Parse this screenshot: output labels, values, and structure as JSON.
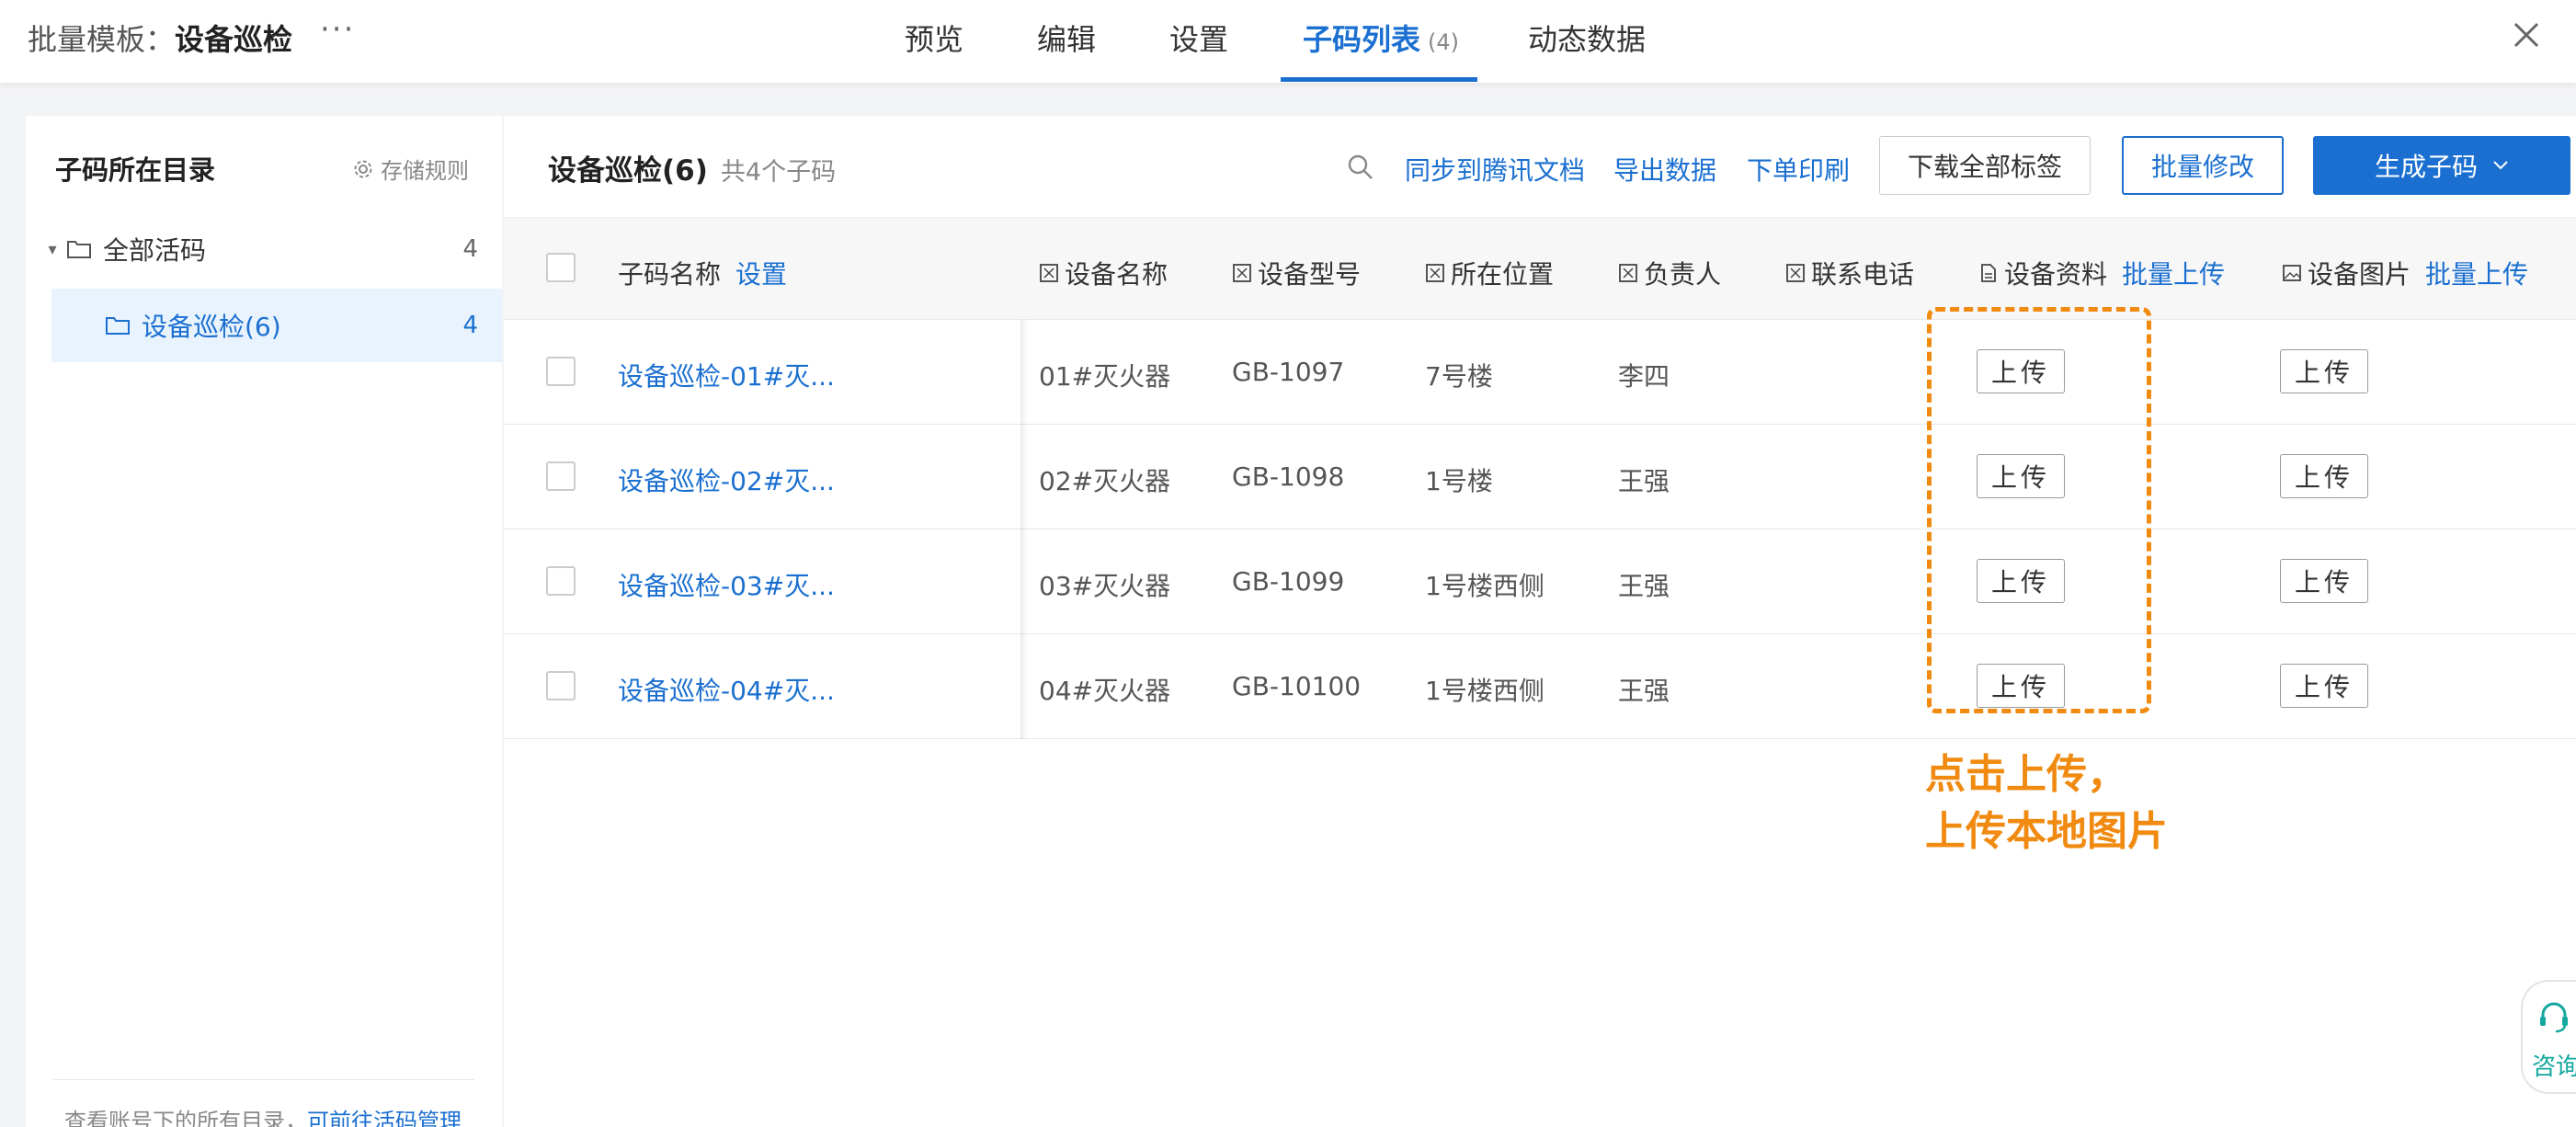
{
  "header": {
    "title_prefix": "批量模板：",
    "title_name": "设备巡检",
    "more": "···",
    "tabs": [
      {
        "label": "预览"
      },
      {
        "label": "编辑"
      },
      {
        "label": "设置"
      },
      {
        "label": "子码列表",
        "count": "(4)"
      },
      {
        "label": "动态数据"
      }
    ]
  },
  "sidebar": {
    "title": "子码所在目录",
    "storage_rule": "存储规则",
    "root": {
      "label": "全部活码",
      "count": "4"
    },
    "child": {
      "label": "设备巡检(6)",
      "count": "4"
    },
    "footer_text": "查看账号下的所有目录，",
    "footer_link": "可前往活码管理"
  },
  "main": {
    "title": "设备巡检(6)",
    "subtitle": "共4个子码",
    "actions": {
      "sync": "同步到腾讯文档",
      "export": "导出数据",
      "print": "下单印刷",
      "download": "下载全部标签",
      "batch_edit": "批量修改",
      "generate": "生成子码"
    },
    "columns": {
      "name": "子码名称",
      "name_setting": "设置",
      "device_name": "设备名称",
      "device_model": "设备型号",
      "location": "所在位置",
      "owner": "负责人",
      "phone": "联系电话",
      "docs": "设备资料",
      "docs_batch": "批量上传",
      "images": "设备图片",
      "images_batch": "批量上传"
    },
    "upload_label": "上传",
    "rows": [
      {
        "name": "设备巡检-01#灭...",
        "device_name": "01#灭火器",
        "model": "GB-1097",
        "location": "7号楼",
        "owner": "李四",
        "phone": ""
      },
      {
        "name": "设备巡检-02#灭...",
        "device_name": "02#灭火器",
        "model": "GB-1098",
        "location": "1号楼",
        "owner": "王强",
        "phone": ""
      },
      {
        "name": "设备巡检-03#灭...",
        "device_name": "03#灭火器",
        "model": "GB-1099",
        "location": "1号楼西侧",
        "owner": "王强",
        "phone": ""
      },
      {
        "name": "设备巡检-04#灭...",
        "device_name": "04#灭火器",
        "model": "GB-10100",
        "location": "1号楼西侧",
        "owner": "王强",
        "phone": ""
      }
    ]
  },
  "annotation": {
    "line1": "点击上传，",
    "line2": "上传本地图片"
  },
  "consult": {
    "label": "咨询"
  },
  "colors": {
    "accent": "#1a6fd0",
    "annotation": "#f08a10",
    "selected_bg": "#e8f3fe"
  }
}
